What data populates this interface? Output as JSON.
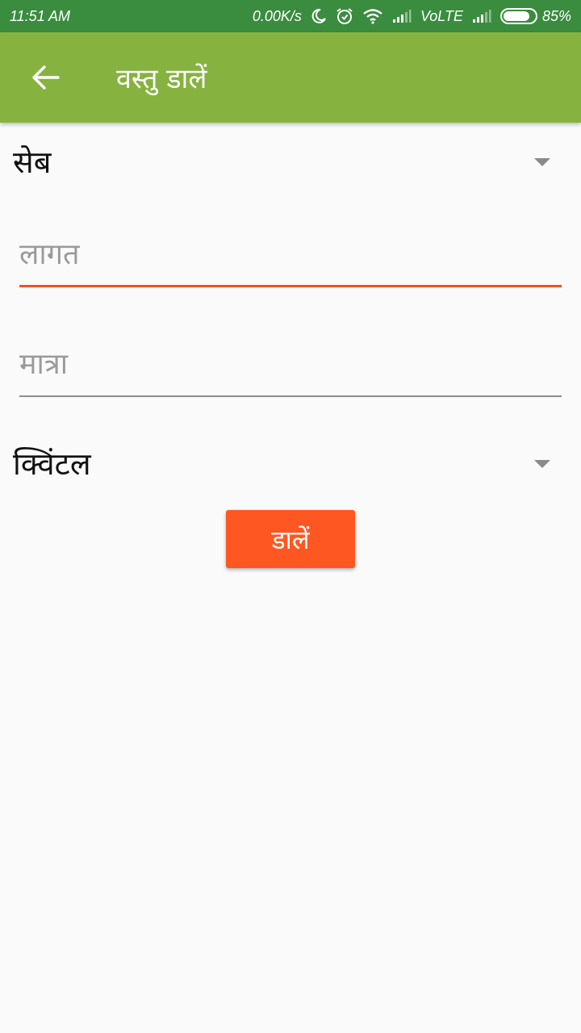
{
  "status_bar": {
    "time": "11:51 AM",
    "network_speed": "0.00K/s",
    "network_type": "VoLTE",
    "battery_percent": "85%",
    "battery_level": 0.85,
    "icons": [
      "moon-icon",
      "alarm-icon",
      "wifi-icon",
      "signal-icon",
      "signal-icon",
      "battery-icon"
    ]
  },
  "app_bar": {
    "back_icon": "arrow-left-icon",
    "title": "वस्तु डालें"
  },
  "form": {
    "crop_selected": "सेब",
    "cost_placeholder": "लागत",
    "cost_value": "",
    "quantity_placeholder": "मात्रा",
    "quantity_value": "",
    "unit_selected": "क्विंटल",
    "submit_label": "डालें"
  },
  "colors": {
    "status_bar": "#3a8c3f",
    "app_bar": "#86b340",
    "accent": "#ff5722",
    "focused_underline": "#f4511e",
    "background": "#fafafa"
  }
}
